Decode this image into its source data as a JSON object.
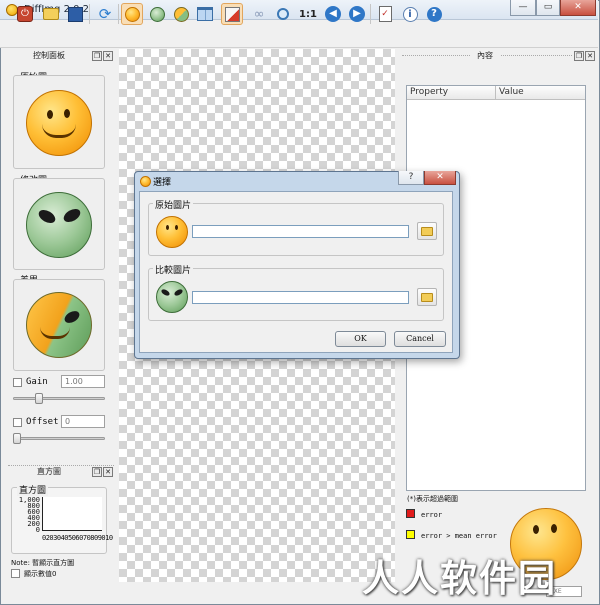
{
  "window": {
    "title": "DiffImg 2.0.2",
    "minimize_label": "—",
    "maximize_label": "▭",
    "close_label": "✕"
  },
  "toolbar": {
    "buttons": [
      "power-icon",
      "open-folder-icon",
      "save-icon",
      "refresh-icon",
      "smiley-icon",
      "alien-icon",
      "difference-icon",
      "layout-icon",
      "highlight-pen-icon",
      "sync-icon",
      "zoom-icon",
      "actual-size-icon",
      "arrow-left-icon",
      "arrow-right-icon",
      "checklist-icon",
      "info-icon",
      "help-icon"
    ],
    "actual_size_label": "1:1",
    "info_label": "i",
    "help_label": "?"
  },
  "left_panel": {
    "title": "控制面板",
    "float_label": "❐",
    "close_label": "✕",
    "original_label": "原始圖",
    "modified_label": "修改圖",
    "difference_label": "差異",
    "gain_label": "Gain",
    "gain_value": "1.00",
    "offset_label": "Offset",
    "offset_value": "0"
  },
  "histogram_panel": {
    "title": "直方圖",
    "group_label": "直方圖",
    "y_ticks": [
      "1,000",
      "800",
      "600",
      "400",
      "200",
      "0"
    ],
    "x_ticks": "0203040506070809010",
    "note": "Note: 暫顯示直方圖",
    "show_values_label": "顯示數值0"
  },
  "right_panel": {
    "title": "內容",
    "col_property": "Property",
    "col_value": "Value",
    "legend_note": "(*)表示超過範圍",
    "legend": [
      {
        "color": "#e01b1b",
        "label": "error"
      },
      {
        "color": "#ffff00",
        "label": "error > mean error"
      }
    ],
    "combo_value": "EXE"
  },
  "dialog": {
    "title": "選擇",
    "help_label": "?",
    "close_label": "✕",
    "original_group": "原始圖片",
    "original_path": "",
    "compare_group": "比較圖片",
    "compare_path": "",
    "ok_label": "OK",
    "cancel_label": "Cancel"
  },
  "watermark": {
    "text": "人人软件园"
  }
}
